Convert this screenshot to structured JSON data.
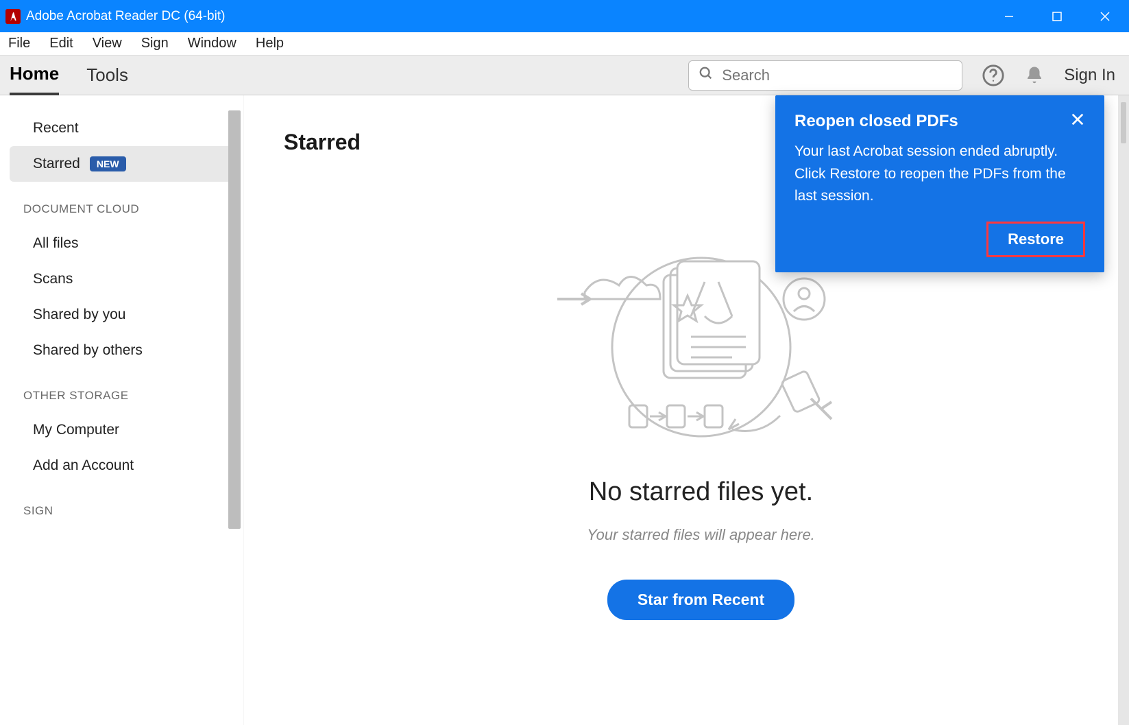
{
  "window": {
    "title": "Adobe Acrobat Reader DC (64-bit)"
  },
  "menubar": {
    "items": [
      "File",
      "Edit",
      "View",
      "Sign",
      "Window",
      "Help"
    ]
  },
  "toolbar": {
    "tabs": {
      "home": "Home",
      "tools": "Tools"
    },
    "search_placeholder": "Search",
    "signin": "Sign In"
  },
  "sidebar": {
    "recent": "Recent",
    "starred": "Starred",
    "starred_badge": "NEW",
    "section_cloud": "DOCUMENT CLOUD",
    "all_files": "All files",
    "scans": "Scans",
    "shared_by_you": "Shared by you",
    "shared_by_others": "Shared by others",
    "section_other": "OTHER STORAGE",
    "my_computer": "My Computer",
    "add_account": "Add an Account",
    "section_sign": "SIGN"
  },
  "main": {
    "title": "Starred",
    "empty_title": "No starred files yet.",
    "empty_sub": "Your starred files will appear here.",
    "cta": "Star from Recent"
  },
  "popup": {
    "title": "Reopen closed PDFs",
    "body": "Your last Acrobat session ended abruptly. Click Restore to reopen the PDFs from the last session.",
    "restore": "Restore"
  }
}
